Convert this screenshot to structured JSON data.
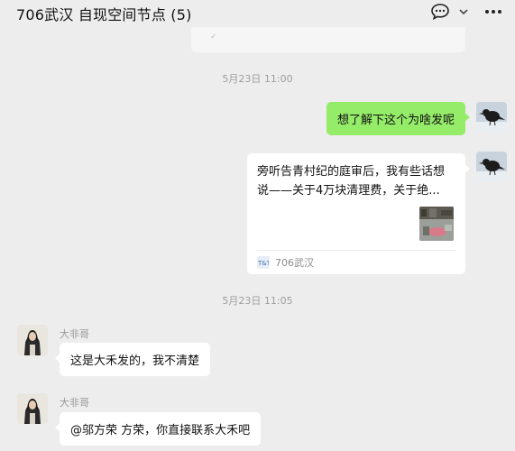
{
  "window": {
    "title": "706武汉 自现空间节点 (5)"
  },
  "messages": {
    "timestamp_1": "5月23日 11:00",
    "msg_self_text": "想了解下这个为啥发呢",
    "link_card": {
      "desc_line1": "旁听告青村纪的庭审后，我有些话想",
      "desc_line2": "说——关于4万块清理费，关于绝...",
      "source": "706武汉"
    },
    "timestamp_2": "5月23日 11:05",
    "reply_1": {
      "sender": "大非哥",
      "text": "这是大禾发的，我不清楚"
    },
    "reply_2": {
      "sender": "大非哥",
      "text": "@邬方荣 方荣，你直接联系大禾吧"
    }
  },
  "colors": {
    "background": "#ededed",
    "bubble_self": "#95ec69",
    "bubble_other": "#ffffff"
  },
  "icons": [
    "chat-bubble-icon",
    "chevron-down-icon",
    "more-icon"
  ]
}
